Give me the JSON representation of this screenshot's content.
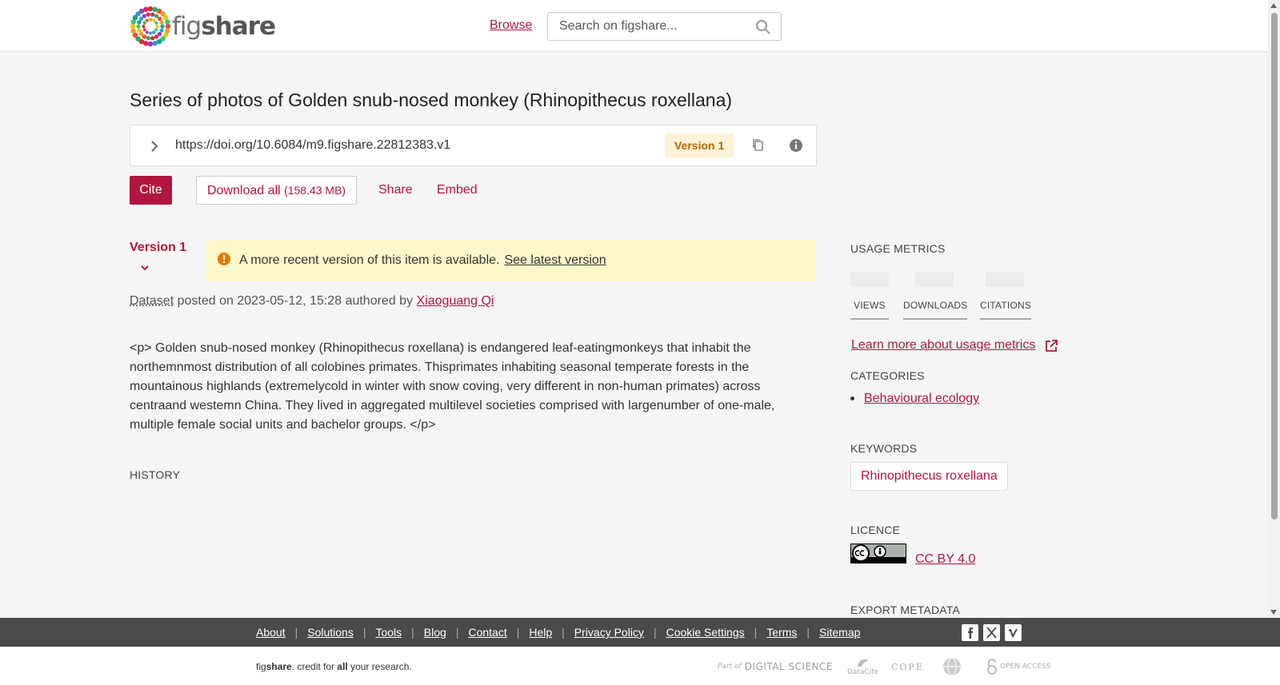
{
  "header": {
    "logo_left": "fig",
    "logo_right": "share",
    "browse": "Browse",
    "search_placeholder": "Search on figshare..."
  },
  "item": {
    "title": "Series of photos of Golden snub-nosed monkey (Rhinopithecus roxellana)",
    "doi_url": "https://doi.org/10.6084/m9.figshare.22812383.v1",
    "version_badge": "Version 1",
    "actions": {
      "cite": "Cite",
      "download_all": "Download all",
      "download_size": "(158.43 MB)",
      "share": "Share",
      "embed": "Embed"
    },
    "version_selector": "Version 1",
    "alert": {
      "text": "A more recent version of this item is available.",
      "link": "See latest version"
    },
    "posted": {
      "type": "Dataset",
      "posted_on_label": "posted on",
      "date": "2023-05-12, 15:28",
      "authored_label": "authored by",
      "author": "Xiaoguang Qi"
    },
    "description": "<p> Golden snub-nosed monkey (Rhinopithecus roxellana) is endangered leaf-eatingmonkeys that inhabit the northemnmost distribution of all colobines primates. Thisprimates inhabiting seasonal temperate forests in the mountainous highlands (extremelycold in winter with snow coving, very different in non-human primates) across centraand westemn China. They lived in aggregated multilevel societies comprised with largenumber of one-male, multiple female social units and bachelor groups.   </p>",
    "history_heading": "HISTORY"
  },
  "sidebar": {
    "usage_metrics": {
      "heading": "USAGE METRICS",
      "tabs": [
        "VIEWS",
        "DOWNLOADS",
        "CITATIONS"
      ],
      "learn_more": "Learn more about usage metrics"
    },
    "categories": {
      "heading": "CATEGORIES",
      "items": [
        "Behavioural ecology"
      ]
    },
    "keywords": {
      "heading": "KEYWORDS",
      "items": [
        "Rhinopithecus roxellana"
      ]
    },
    "licence": {
      "heading": "LICENCE",
      "name": "CC BY 4.0"
    },
    "export_metadata": {
      "heading": "EXPORT METADATA"
    }
  },
  "footer": {
    "links": [
      "About",
      "Solutions",
      "Tools",
      "Blog",
      "Contact",
      "Help",
      "Privacy Policy",
      "Cookie Settings",
      "Terms",
      "Sitemap"
    ],
    "tagline_fig": "fig",
    "tagline_share": "share",
    "tagline_mid": ". credit for ",
    "tagline_all": "all",
    "tagline_end": " your research.",
    "partners": {
      "ds_prefix": "Part of",
      "ds_name": "DIGITAL SCIENCE",
      "datacite": "DataCite",
      "cope": "COPE",
      "open_access": "OPEN ACCESS"
    }
  },
  "colors": {
    "accent": "#b0163e",
    "alert_bg": "#fbf7c8",
    "badge_bg": "#fdf1d6",
    "badge_text": "#b26a00",
    "footer_bg": "#4a4a4a"
  }
}
